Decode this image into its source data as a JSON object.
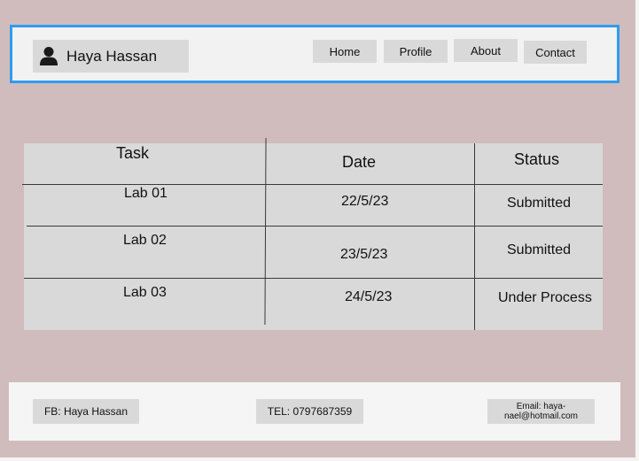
{
  "header": {
    "user_name": "Haya Hassan",
    "nav": [
      {
        "label": "Home"
      },
      {
        "label": "Profile"
      },
      {
        "label": "About"
      },
      {
        "label": "Contact"
      }
    ]
  },
  "table": {
    "columns": [
      "Task",
      "Date",
      "Status"
    ],
    "rows": [
      {
        "task": "Lab 01",
        "date": "22/5/23",
        "status": "Submitted"
      },
      {
        "task": "Lab 02",
        "date": "23/5/23",
        "status": "Submitted"
      },
      {
        "task": "Lab 03",
        "date": "24/5/23",
        "status": "Under Process"
      }
    ]
  },
  "footer": {
    "facebook": "FB: Haya Hassan",
    "phone": "TEL: 0797687359",
    "email": "Email: haya-nael@hotmail.com"
  },
  "colors": {
    "background": "#d0bcbc",
    "header_border": "#2f9cf0",
    "box": "#d9d9d9"
  }
}
